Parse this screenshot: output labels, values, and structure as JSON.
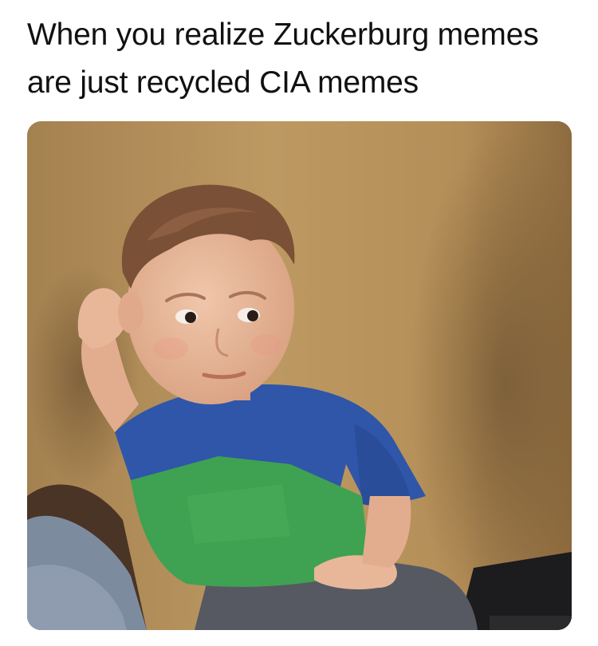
{
  "caption": {
    "line1": "When you realize Zuckerburg memes",
    "line2": "are just recycled CIA memes"
  },
  "photo": {
    "subject": "boy-sitting-on-couch-skeptical-look",
    "colors": {
      "wall": "#b08a55",
      "wall_shadow": "#8a6a40",
      "skin": "#e8b79a",
      "hair": "#7a5036",
      "shirt_blue": "#2f56a8",
      "shirt_green": "#3fa152",
      "pants": "#5a5d64",
      "couch": "#4a3426"
    }
  }
}
